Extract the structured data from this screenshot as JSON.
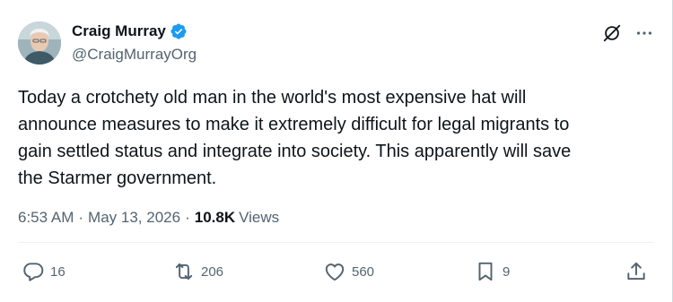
{
  "author": {
    "display_name": "Craig Murray",
    "handle": "@CraigMurrayOrg",
    "verified": true,
    "avatar_icon": "user-avatar-photo"
  },
  "tweet": {
    "text": "Today a crotchety old man in the world's most expensive hat will\nannounce measures to make it extremely difficult for legal migrants to\ngain settled status and integrate into society. This apparently will save\nthe Starmer government."
  },
  "meta": {
    "time": "6:53 AM",
    "separator": "·",
    "date": "May 13, 2026",
    "views_count": "10.8K",
    "views_label": "Views"
  },
  "actions": {
    "replies": "16",
    "reposts": "206",
    "likes": "560",
    "bookmarks": "9"
  },
  "icons": {
    "top": [
      "grok-icon",
      "more-icon"
    ],
    "actions": [
      "reply-icon",
      "repost-icon",
      "like-icon",
      "bookmark-icon",
      "share-icon"
    ]
  },
  "colors": {
    "text_primary": "#0f1419",
    "text_secondary": "#536471",
    "verified_blue": "#1d9bf0"
  }
}
